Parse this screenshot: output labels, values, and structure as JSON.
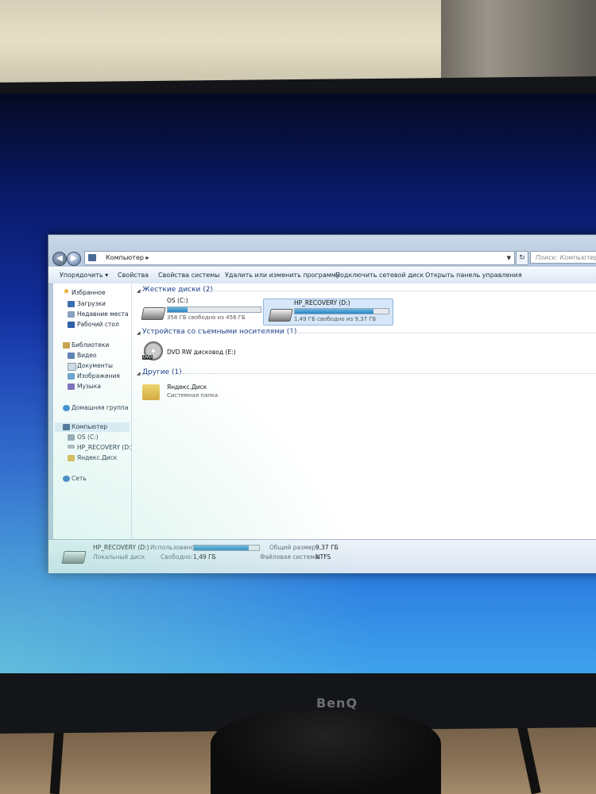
{
  "window": {
    "address_crumb": "Компьютер",
    "address_arrow": "▸",
    "search_placeholder": "Поиск: Компьютер"
  },
  "toolbar": {
    "organize": "Упорядочить ▾",
    "properties": "Свойства",
    "system_properties": "Свойства системы",
    "uninstall": "Удалить или изменить программу",
    "map_drive": "Подключить сетевой диск",
    "control_panel": "Открыть панель управления"
  },
  "sidebar": {
    "favorites": "Избранное",
    "downloads": "Загрузки",
    "recent": "Недавние места",
    "desktop": "Рабочий стол",
    "libraries": "Библиотеки",
    "video": "Видео",
    "documents": "Документы",
    "images": "Изображения",
    "music": "Музыка",
    "homegroup": "Домашняя группа",
    "computer": "Компьютер",
    "drive_c": "OS (C:)",
    "drive_d": "HP_RECOVERY (D:)",
    "yandex": "Яндекс.Диск",
    "network": "Сеть"
  },
  "groups": {
    "hdd": "Жесткие диски (2)",
    "removable": "Устройства со съемными носителями (1)",
    "other": "Другие (1)"
  },
  "drives": {
    "c": {
      "name": "OS (C:)",
      "free": "358 ГБ свободно из 456 ГБ",
      "used_fraction": 0.215
    },
    "d": {
      "name": "HP_RECOVERY (D:)",
      "free": "1,49 ГБ свободно из 9,37 ГБ",
      "used_fraction": 0.84
    },
    "dvd": {
      "name": "DVD RW дисковод (E:)",
      "icon_text": "DVD"
    },
    "yandex": {
      "name": "Яндекс.Диск",
      "type": "Системная папка"
    }
  },
  "details": {
    "name": "HP_RECOVERY (D:)",
    "type": "Локальный диск",
    "used_label": "Использовано:",
    "used_fraction": 0.84,
    "free_label": "Свободно:",
    "free_value": "1,49 ГБ",
    "total_label": "Общий размер:",
    "total_value": "9,37 ГБ",
    "fs_label": "Файловая система:",
    "fs_value": "NTFS"
  },
  "monitor": {
    "brand": "BenQ"
  }
}
